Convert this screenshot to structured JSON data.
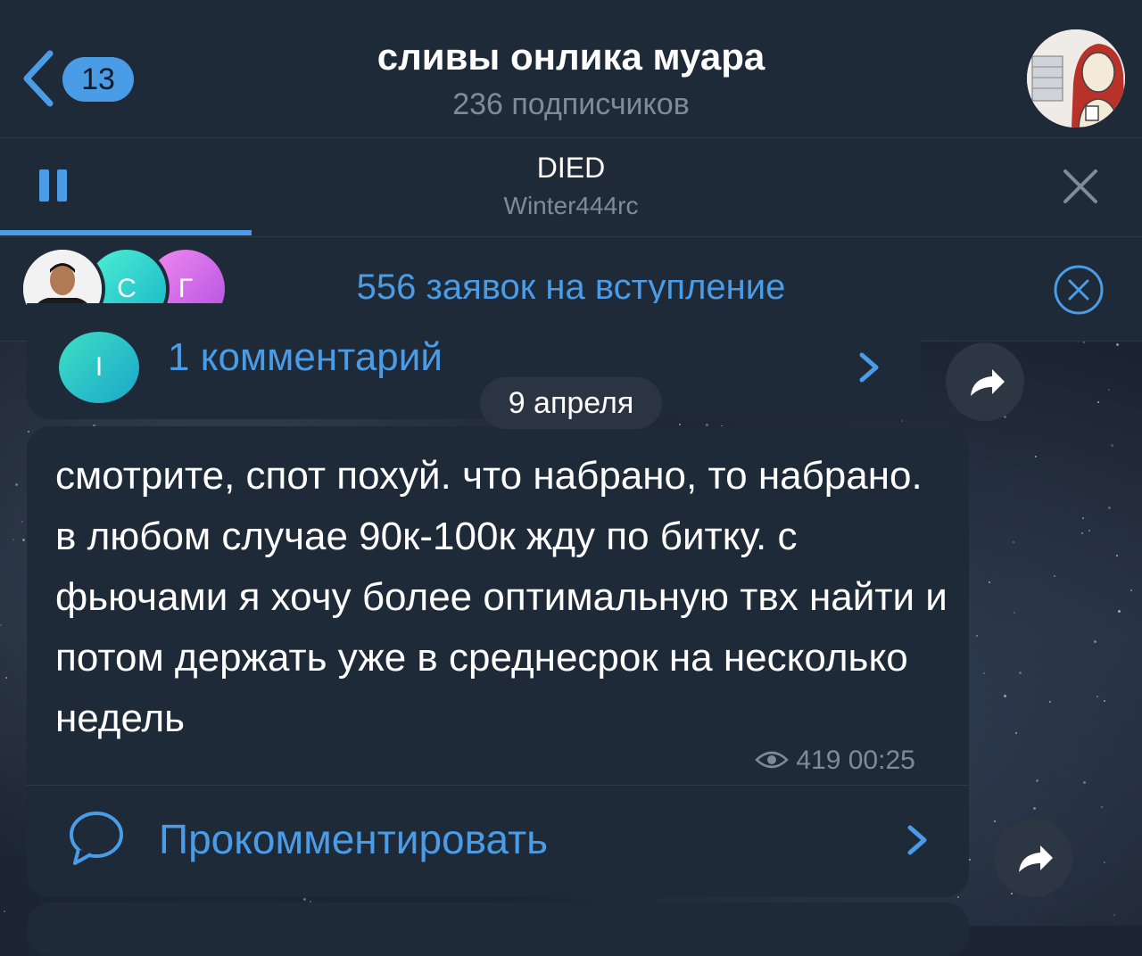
{
  "header": {
    "back_badge": "13",
    "title": "сливы онлика муара",
    "subtitle": "236 подписчиков"
  },
  "player": {
    "track_title": "DIED",
    "track_artist": "Winter444rc",
    "progress": 0.22
  },
  "join_requests": {
    "text": "556 заявок на вступление",
    "avatars": [
      {
        "letter": ""
      },
      {
        "letter": "С"
      },
      {
        "letter": "Г"
      }
    ]
  },
  "prev_post": {
    "commenter_letter": "I",
    "comments_label": "1 комментарий"
  },
  "date_separator": "9 апреля",
  "post": {
    "text": "смотрите, спот похуй. что набрано, то набрано. в любом случае 90к-100к жду по битку. с фьючами я хочу более оптимальную твх найти и потом держать уже в среднесрок на несколько недель",
    "views": "419",
    "time": "00:25",
    "comment_action": "Прокомментировать"
  },
  "colors": {
    "accent": "#4a9ce6",
    "panel": "#1f2a38",
    "muted": "#7e8b9b"
  }
}
